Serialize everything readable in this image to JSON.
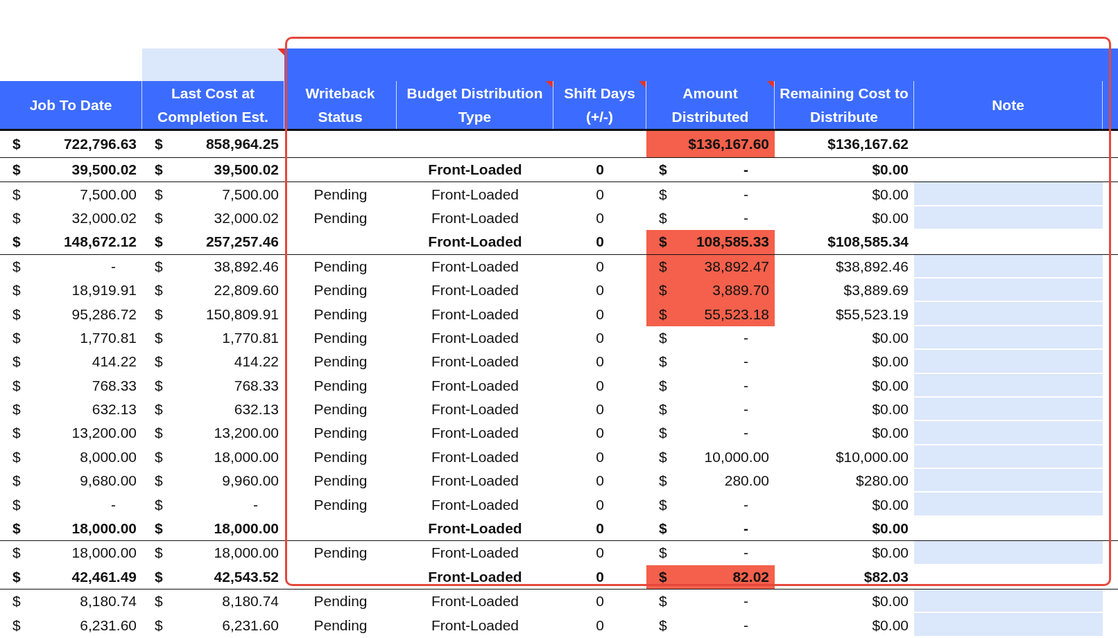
{
  "band": {
    "left_cell_comment": true
  },
  "columns": [
    {
      "label": "Job To Date",
      "comment": false
    },
    {
      "label": "Last Cost at Completion Est.",
      "comment": false
    },
    {
      "label": "Writeback Status",
      "comment": false
    },
    {
      "label": "Budget Distribution Type",
      "comment": true
    },
    {
      "label": "Shift Days (+/-)",
      "comment": true
    },
    {
      "label": "Amount Distributed",
      "comment": true
    },
    {
      "label": "Remaining Cost to Distribute",
      "comment": false
    },
    {
      "label": "Note",
      "comment": false
    }
  ],
  "rows": [
    {
      "kind": "grand",
      "job": {
        "currency": "$",
        "value": "722,796.63"
      },
      "lcc": {
        "currency": "$",
        "value": "858,964.25"
      },
      "amount": {
        "value": "$136,167.60",
        "highlight": true
      },
      "remaining": "$136,167.62"
    },
    {
      "kind": "group",
      "job": {
        "currency": "$",
        "value": "39,500.02"
      },
      "lcc": {
        "currency": "$",
        "value": "39,500.02"
      },
      "type": "Front-Loaded",
      "shift": "0",
      "amount": {
        "currency": "$",
        "value": "-",
        "zero": true,
        "highlight": false
      },
      "remaining": "$0.00"
    },
    {
      "kind": "detail",
      "job": {
        "currency": "$",
        "value": "7,500.00"
      },
      "lcc": {
        "currency": "$",
        "value": "7,500.00"
      },
      "status": "Pending",
      "type": "Front-Loaded",
      "shift": "0",
      "amount": {
        "currency": "$",
        "value": "-",
        "zero": true,
        "highlight": false
      },
      "remaining": "$0.00"
    },
    {
      "kind": "detail",
      "job": {
        "currency": "$",
        "value": "32,000.02"
      },
      "lcc": {
        "currency": "$",
        "value": "32,000.02"
      },
      "status": "Pending",
      "type": "Front-Loaded",
      "shift": "0",
      "amount": {
        "currency": "$",
        "value": "-",
        "zero": true,
        "highlight": false
      },
      "remaining": "$0.00"
    },
    {
      "kind": "group",
      "job": {
        "currency": "$",
        "value": "148,672.12"
      },
      "lcc": {
        "currency": "$",
        "value": "257,257.46"
      },
      "type": "Front-Loaded",
      "shift": "0",
      "amount": {
        "currency": "$",
        "value": "108,585.33",
        "highlight": true
      },
      "remaining": "$108,585.34"
    },
    {
      "kind": "detail",
      "job": {
        "currency": "$",
        "value": "-",
        "zero": true
      },
      "lcc": {
        "currency": "$",
        "value": "38,892.46"
      },
      "status": "Pending",
      "type": "Front-Loaded",
      "shift": "0",
      "amount": {
        "currency": "$",
        "value": "38,892.47",
        "highlight": true
      },
      "remaining": "$38,892.46"
    },
    {
      "kind": "detail",
      "job": {
        "currency": "$",
        "value": "18,919.91"
      },
      "lcc": {
        "currency": "$",
        "value": "22,809.60"
      },
      "status": "Pending",
      "type": "Front-Loaded",
      "shift": "0",
      "amount": {
        "currency": "$",
        "value": "3,889.70",
        "highlight": true
      },
      "remaining": "$3,889.69"
    },
    {
      "kind": "detail",
      "job": {
        "currency": "$",
        "value": "95,286.72"
      },
      "lcc": {
        "currency": "$",
        "value": "150,809.91"
      },
      "status": "Pending",
      "type": "Front-Loaded",
      "shift": "0",
      "amount": {
        "currency": "$",
        "value": "55,523.18",
        "highlight": true
      },
      "remaining": "$55,523.19"
    },
    {
      "kind": "detail",
      "job": {
        "currency": "$",
        "value": "1,770.81"
      },
      "lcc": {
        "currency": "$",
        "value": "1,770.81"
      },
      "status": "Pending",
      "type": "Front-Loaded",
      "shift": "0",
      "amount": {
        "currency": "$",
        "value": "-",
        "zero": true,
        "highlight": false
      },
      "remaining": "$0.00"
    },
    {
      "kind": "detail",
      "job": {
        "currency": "$",
        "value": "414.22"
      },
      "lcc": {
        "currency": "$",
        "value": "414.22"
      },
      "status": "Pending",
      "type": "Front-Loaded",
      "shift": "0",
      "amount": {
        "currency": "$",
        "value": "-",
        "zero": true,
        "highlight": false
      },
      "remaining": "$0.00"
    },
    {
      "kind": "detail",
      "job": {
        "currency": "$",
        "value": "768.33"
      },
      "lcc": {
        "currency": "$",
        "value": "768.33"
      },
      "status": "Pending",
      "type": "Front-Loaded",
      "shift": "0",
      "amount": {
        "currency": "$",
        "value": "-",
        "zero": true,
        "highlight": false
      },
      "remaining": "$0.00"
    },
    {
      "kind": "detail",
      "job": {
        "currency": "$",
        "value": "632.13"
      },
      "lcc": {
        "currency": "$",
        "value": "632.13"
      },
      "status": "Pending",
      "type": "Front-Loaded",
      "shift": "0",
      "amount": {
        "currency": "$",
        "value": "-",
        "zero": true,
        "highlight": false
      },
      "remaining": "$0.00"
    },
    {
      "kind": "detail",
      "job": {
        "currency": "$",
        "value": "13,200.00"
      },
      "lcc": {
        "currency": "$",
        "value": "13,200.00"
      },
      "status": "Pending",
      "type": "Front-Loaded",
      "shift": "0",
      "amount": {
        "currency": "$",
        "value": "-",
        "zero": true,
        "highlight": false
      },
      "remaining": "$0.00"
    },
    {
      "kind": "detail",
      "job": {
        "currency": "$",
        "value": "8,000.00"
      },
      "lcc": {
        "currency": "$",
        "value": "18,000.00"
      },
      "status": "Pending",
      "type": "Front-Loaded",
      "shift": "0",
      "amount": {
        "currency": "$",
        "value": "10,000.00",
        "highlight": false
      },
      "remaining": "$10,000.00"
    },
    {
      "kind": "detail",
      "job": {
        "currency": "$",
        "value": "9,680.00"
      },
      "lcc": {
        "currency": "$",
        "value": "9,960.00"
      },
      "status": "Pending",
      "type": "Front-Loaded",
      "shift": "0",
      "amount": {
        "currency": "$",
        "value": "280.00",
        "highlight": false
      },
      "remaining": "$280.00"
    },
    {
      "kind": "detail",
      "job": {
        "currency": "$",
        "value": "-",
        "zero": true
      },
      "lcc": {
        "currency": "$",
        "value": "-",
        "zero": true
      },
      "status": "Pending",
      "type": "Front-Loaded",
      "shift": "0",
      "amount": {
        "currency": "$",
        "value": "-",
        "zero": true,
        "highlight": false
      },
      "remaining": "$0.00"
    },
    {
      "kind": "group",
      "job": {
        "currency": "$",
        "value": "18,000.00"
      },
      "lcc": {
        "currency": "$",
        "value": "18,000.00"
      },
      "type": "Front-Loaded",
      "shift": "0",
      "amount": {
        "currency": "$",
        "value": "-",
        "zero": true,
        "highlight": false
      },
      "remaining": "$0.00"
    },
    {
      "kind": "detail",
      "job": {
        "currency": "$",
        "value": "18,000.00"
      },
      "lcc": {
        "currency": "$",
        "value": "18,000.00"
      },
      "status": "Pending",
      "type": "Front-Loaded",
      "shift": "0",
      "amount": {
        "currency": "$",
        "value": "-",
        "zero": true,
        "highlight": false
      },
      "remaining": "$0.00"
    },
    {
      "kind": "group",
      "job": {
        "currency": "$",
        "value": "42,461.49"
      },
      "lcc": {
        "currency": "$",
        "value": "42,543.52"
      },
      "type": "Front-Loaded",
      "shift": "0",
      "amount": {
        "currency": "$",
        "value": "82.02",
        "highlight": true
      },
      "remaining": "$82.03"
    },
    {
      "kind": "detail",
      "job": {
        "currency": "$",
        "value": "8,180.74"
      },
      "lcc": {
        "currency": "$",
        "value": "8,180.74"
      },
      "status": "Pending",
      "type": "Front-Loaded",
      "shift": "0",
      "amount": {
        "currency": "$",
        "value": "-",
        "zero": true,
        "highlight": false
      },
      "remaining": "$0.00"
    },
    {
      "kind": "detail",
      "job": {
        "currency": "$",
        "value": "6,231.60"
      },
      "lcc": {
        "currency": "$",
        "value": "6,231.60"
      },
      "status": "Pending",
      "type": "Front-Loaded",
      "shift": "0",
      "amount": {
        "currency": "$",
        "value": "-",
        "zero": true,
        "highlight": false
      },
      "remaining": "$0.00"
    }
  ],
  "highlight_frame": {
    "shown": true
  }
}
